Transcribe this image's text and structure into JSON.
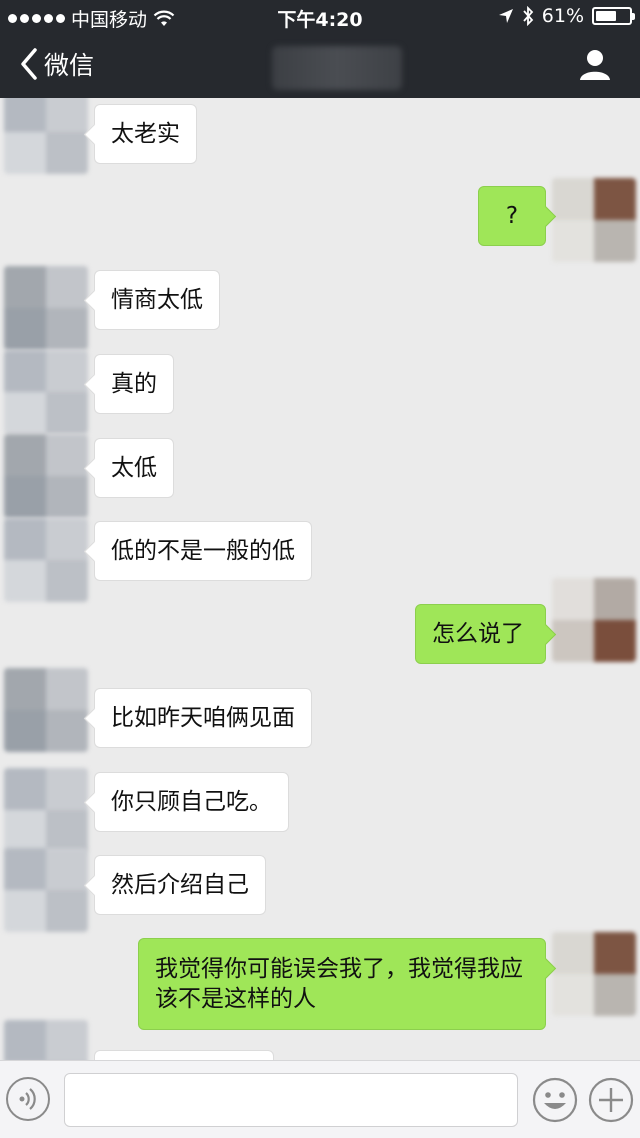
{
  "status_bar": {
    "carrier": "中国移动",
    "time": "下午4:20",
    "battery": "61%",
    "battery_level": 0.61,
    "icons": [
      "signal-dots-icon",
      "wifi-icon",
      "location-arrow-icon",
      "bluetooth-icon",
      "battery-icon"
    ]
  },
  "nav": {
    "back_label": "微信",
    "icons": [
      "chevron-left-icon",
      "profile-icon"
    ]
  },
  "messages": [
    {
      "side": "in",
      "text": "太老实"
    },
    {
      "side": "out",
      "text": "?"
    },
    {
      "side": "in",
      "text": "情商太低"
    },
    {
      "side": "in",
      "text": "真的"
    },
    {
      "side": "in",
      "text": "太低"
    },
    {
      "side": "in",
      "text": "低的不是一般的低"
    },
    {
      "side": "out",
      "text": "怎么说了"
    },
    {
      "side": "in",
      "text": "比如昨天咱俩见面"
    },
    {
      "side": "in",
      "text": "你只顾自己吃。"
    },
    {
      "side": "in",
      "text": "然后介绍自己"
    },
    {
      "side": "out",
      "text": "我觉得你可能误会我了，我觉得我应该不是这样的人"
    }
  ],
  "input_bar": {
    "placeholder": "",
    "icons": [
      "voice-icon",
      "emoji-icon",
      "plus-icon"
    ]
  },
  "colors": {
    "header": "#26292e",
    "chat_background": "#ebebeb",
    "outgoing_bubble": "#9fe658",
    "incoming_bubble": "#ffffff"
  }
}
